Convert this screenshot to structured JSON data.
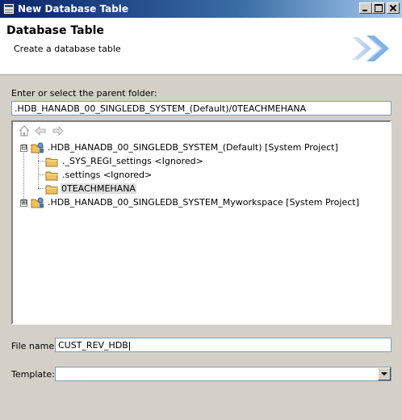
{
  "window": {
    "title": "New Database Table",
    "icon": "table-app-icon",
    "controls": [
      "minimize-icon",
      "maximize-icon",
      "close-icon"
    ]
  },
  "header": {
    "title": "Database Table",
    "description": "Create a database table",
    "banner_icon": "double-chevron-right-icon"
  },
  "parent_folder": {
    "label": "Enter or select the parent folder:",
    "value": ".HDB_HANADB_00_SINGLEDB_SYSTEM_(Default)/0TEACHMEHANA"
  },
  "tree": {
    "toolbar": [
      "home-icon",
      "back-arrow-icon",
      "forward-arrow-icon"
    ],
    "items": [
      {
        "label": ".HDB_HANADB_00_SINGLEDB_SYSTEM_(Default) [System Project]",
        "expander": "⊟",
        "icon": "project-folder-icon",
        "depth": 0
      },
      {
        "label": "._SYS_REGI_settings <Ignored>",
        "icon": "folder-icon",
        "depth": 1
      },
      {
        "label": ".settings <Ignored>",
        "icon": "folder-icon",
        "depth": 1
      },
      {
        "label": "0TEACHMEHANA",
        "icon": "folder-icon",
        "depth": 1,
        "selected": true
      },
      {
        "label": ".HDB_HANADB_00_SINGLEDB_SYSTEM_Myworkspace [System Project]",
        "expander": "⊞",
        "icon": "project-folder-icon",
        "depth": 0
      }
    ]
  },
  "file_name": {
    "label": "File name:",
    "value": "CUST_REV_HDB"
  },
  "template": {
    "label": "Template:",
    "value": ""
  },
  "colors": {
    "titlebar_start": "#0a246a",
    "titlebar_end": "#a6caf0",
    "dialog_bg": "#d4d0c8",
    "selection": "#e0e0e0",
    "folder": "#f0c060"
  }
}
